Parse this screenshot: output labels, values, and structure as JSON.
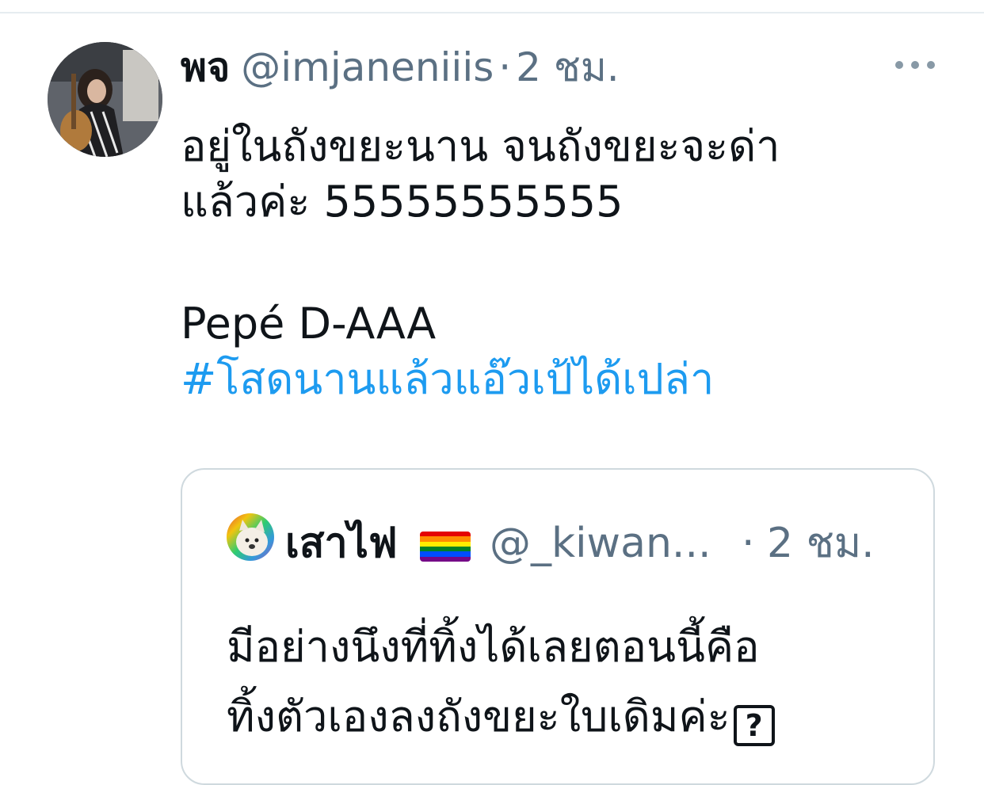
{
  "tweet": {
    "display_name": "พจ",
    "handle": "@imjaneniiis",
    "separator": "·",
    "time": "2 ชม.",
    "more_icon": "more-horizontal-icon",
    "text_line_1": "อยู่ในถังขยะนาน จนถังขยะจะด่า",
    "text_line_2": "แล้วค่ะ 55555555555",
    "text_line_3": "Pepé D-AAA",
    "hashtag": "#โสดนานแล้วแอ๊วเป้ได้เปล่า"
  },
  "quoted_tweet": {
    "display_name": "เสาไฟ",
    "flag_icon": "rainbow-flag-icon",
    "handle": "@_kiwan...",
    "separator": "·",
    "time": "2 ชม.",
    "text_line_1": "มีอย่างนึงที่ทิ้งได้เลยตอนนี้คือ",
    "text_line_2": "ทิ้งตัวเองลงถังขยะใบเดิมค่ะ",
    "box_glyph": "?"
  },
  "colors": {
    "text": "#0f1419",
    "secondary": "#5b7083",
    "link": "#1d9bf0",
    "border": "#cfd9de"
  }
}
